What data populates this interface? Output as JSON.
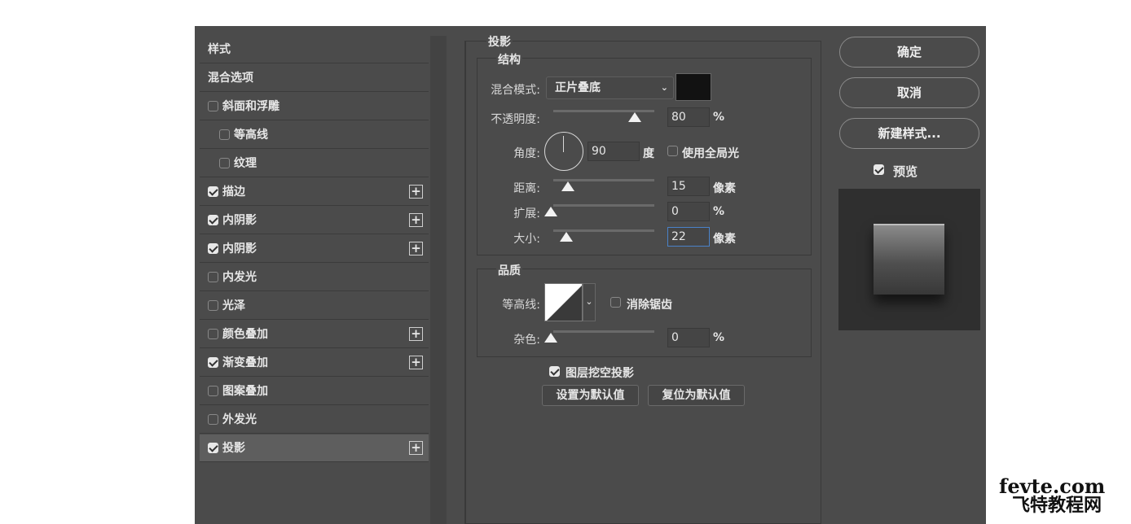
{
  "style_list": {
    "header": "样式",
    "blend_options": "混合选项",
    "items": [
      {
        "label": "斜面和浮雕",
        "checked": false,
        "plus": false,
        "indent": false
      },
      {
        "label": "等高线",
        "checked": false,
        "plus": false,
        "indent": true
      },
      {
        "label": "纹理",
        "checked": false,
        "plus": false,
        "indent": true
      },
      {
        "label": "描边",
        "checked": true,
        "plus": true,
        "indent": false
      },
      {
        "label": "内阴影",
        "checked": true,
        "plus": true,
        "indent": false
      },
      {
        "label": "内阴影",
        "checked": true,
        "plus": true,
        "indent": false
      },
      {
        "label": "内发光",
        "checked": false,
        "plus": false,
        "indent": false
      },
      {
        "label": "光泽",
        "checked": false,
        "plus": false,
        "indent": false
      },
      {
        "label": "颜色叠加",
        "checked": false,
        "plus": true,
        "indent": false
      },
      {
        "label": "渐变叠加",
        "checked": true,
        "plus": true,
        "indent": false
      },
      {
        "label": "图案叠加",
        "checked": false,
        "plus": false,
        "indent": false
      },
      {
        "label": "外发光",
        "checked": false,
        "plus": false,
        "indent": false
      },
      {
        "label": "投影",
        "checked": true,
        "plus": true,
        "indent": false,
        "selected": true
      }
    ]
  },
  "panel": {
    "title": "投影",
    "structure": {
      "title": "结构",
      "blend_mode_label": "混合模式:",
      "blend_mode_value": "正片叠底",
      "shadow_color": "#121212",
      "opacity_label": "不透明度:",
      "opacity_value": "80",
      "percent": "%",
      "angle_label": "角度:",
      "angle_value": "90",
      "angle_unit": "度",
      "global_light_label": "使用全局光",
      "distance_label": "距离:",
      "distance_value": "15",
      "distance_unit": "像素",
      "spread_label": "扩展:",
      "spread_value": "0",
      "size_label": "大小:",
      "size_value": "22",
      "size_unit": "像素"
    },
    "quality": {
      "title": "品质",
      "contour_label": "等高线:",
      "anti_alias_label": "消除锯齿",
      "noise_label": "杂色:",
      "noise_value": "0",
      "percent": "%"
    },
    "knockout_label": "图层挖空投影",
    "set_default": "设置为默认值",
    "reset_default": "复位为默认值"
  },
  "buttons": {
    "ok": "确定",
    "cancel": "取消",
    "new_style": "新建样式...",
    "preview_label": "预览"
  },
  "watermark": {
    "line1": "fevte.com",
    "line2": "飞特教程网"
  }
}
